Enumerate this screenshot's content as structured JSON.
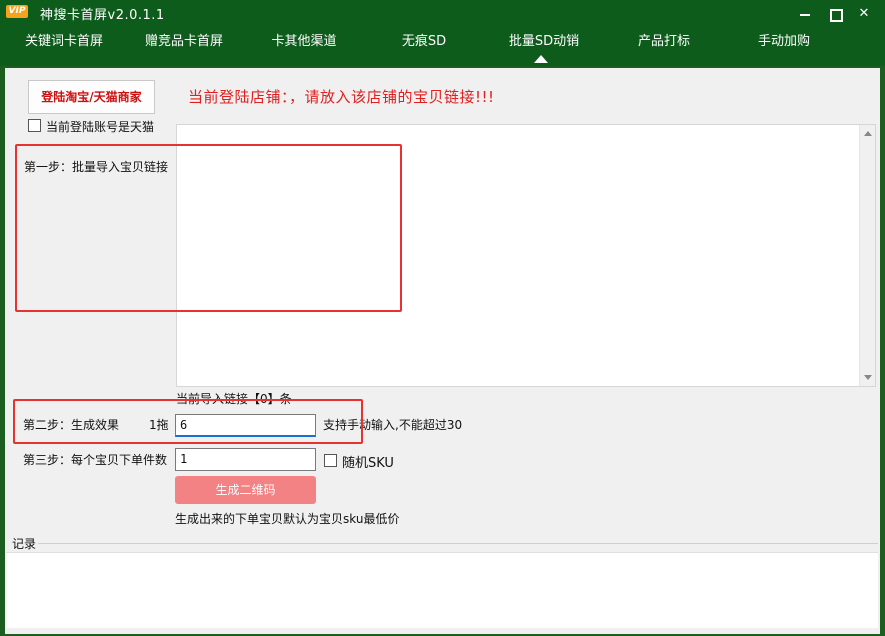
{
  "window": {
    "title": "神搜卡首屏v2.0.1.1",
    "badge": "VIP",
    "minimize_glyph": "",
    "maximize_glyph": "",
    "close_glyph": "✕"
  },
  "tabs": [
    {
      "label": "关键词卡首屏"
    },
    {
      "label": "赠竞品卡首屏"
    },
    {
      "label": "卡其他渠道"
    },
    {
      "label": "无痕SD"
    },
    {
      "label": "批量SD动销",
      "active": true
    },
    {
      "label": "产品打标"
    },
    {
      "label": "手动加购"
    }
  ],
  "login": {
    "button_label": "登陆淘宝/天猫商家",
    "store_message": "当前登陆店铺：，请放入该店铺的宝贝链接!!!",
    "tmall_checkbox_label": "当前登陆账号是天猫",
    "tmall_checked": false
  },
  "step1": {
    "label": "第一步：批量导入宝贝链接",
    "links_value": "",
    "count_label": "当前导入链接【0】条"
  },
  "step2": {
    "label": "第二步：生成效果",
    "drag_label": "1拖",
    "drag_value": "6",
    "hint": "支持手动输入,不能超过30"
  },
  "step3": {
    "label": "第三步：每个宝贝下单件数",
    "qty_value": "1",
    "random_sku_label": "随机SKU",
    "random_sku_checked": false
  },
  "generate": {
    "button_label": "生成二维码",
    "note": "生成出来的下单宝贝默认为宝贝sku最低价"
  },
  "record": {
    "label": "记录",
    "content": ""
  },
  "colors": {
    "titlebar": "#0d5c1c",
    "accent_red": "#e02020",
    "generate_button": "#f28283",
    "highlight_box": "#e83232"
  }
}
